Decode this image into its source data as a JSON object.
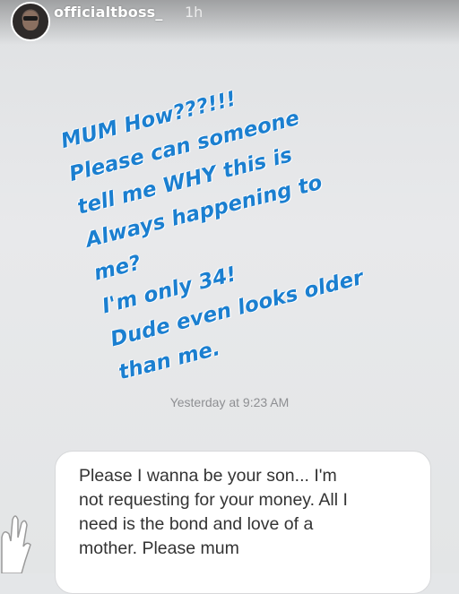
{
  "header": {
    "username": "officialtboss_",
    "time": "1h"
  },
  "caption": {
    "lines": [
      "MUM How???!!!",
      "Please can someone",
      "tell me WHY this is",
      "Always happening to",
      "me?",
      "I'm only 34!",
      "Dude even looks older",
      "than me."
    ]
  },
  "message": {
    "timestamp": "Yesterday at 9:23 AM",
    "lines": [
      "Please I wanna be your  son... I'm",
      "not requesting for your money. All I",
      "need is the bond and love of a",
      "mother. Please mum"
    ]
  },
  "colors": {
    "caption_text": "#1b7fd0",
    "bubble_background": "#ffffff",
    "page_background": "#e4e6e8"
  }
}
